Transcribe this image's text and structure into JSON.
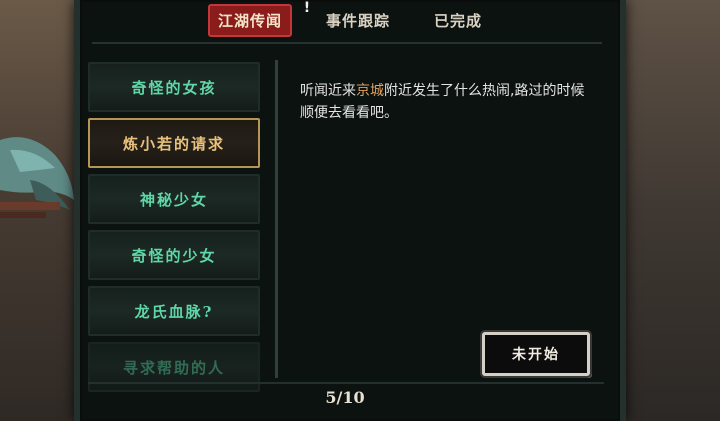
{
  "tabs": [
    {
      "label": "江湖传闻",
      "active": true
    },
    {
      "label": "事件跟踪",
      "active": false
    },
    {
      "label": "已完成",
      "active": false
    }
  ],
  "alert_icon": "exclamation-icon",
  "quests": [
    {
      "label": "奇怪的女孩",
      "state": "normal"
    },
    {
      "label": "炼小若的请求",
      "state": "selected"
    },
    {
      "label": "神秘少女",
      "state": "normal"
    },
    {
      "label": "奇怪的少女",
      "state": "normal"
    },
    {
      "label": "龙氏血脉?",
      "state": "normal"
    },
    {
      "label": "寻求帮助的人",
      "state": "faded"
    }
  ],
  "description": {
    "part1": "听闻近来",
    "highlight": "京城",
    "part2": "附近发生了什么热闹,路过的时候顺便去看看吧。"
  },
  "status_button": "未开始",
  "page_indicator": "5/10",
  "colors": {
    "active_tab": "#8a1c1c",
    "quest_text": "#5fd7a8",
    "selected_quest_text": "#e8c27c",
    "highlight": "#e0a060"
  }
}
